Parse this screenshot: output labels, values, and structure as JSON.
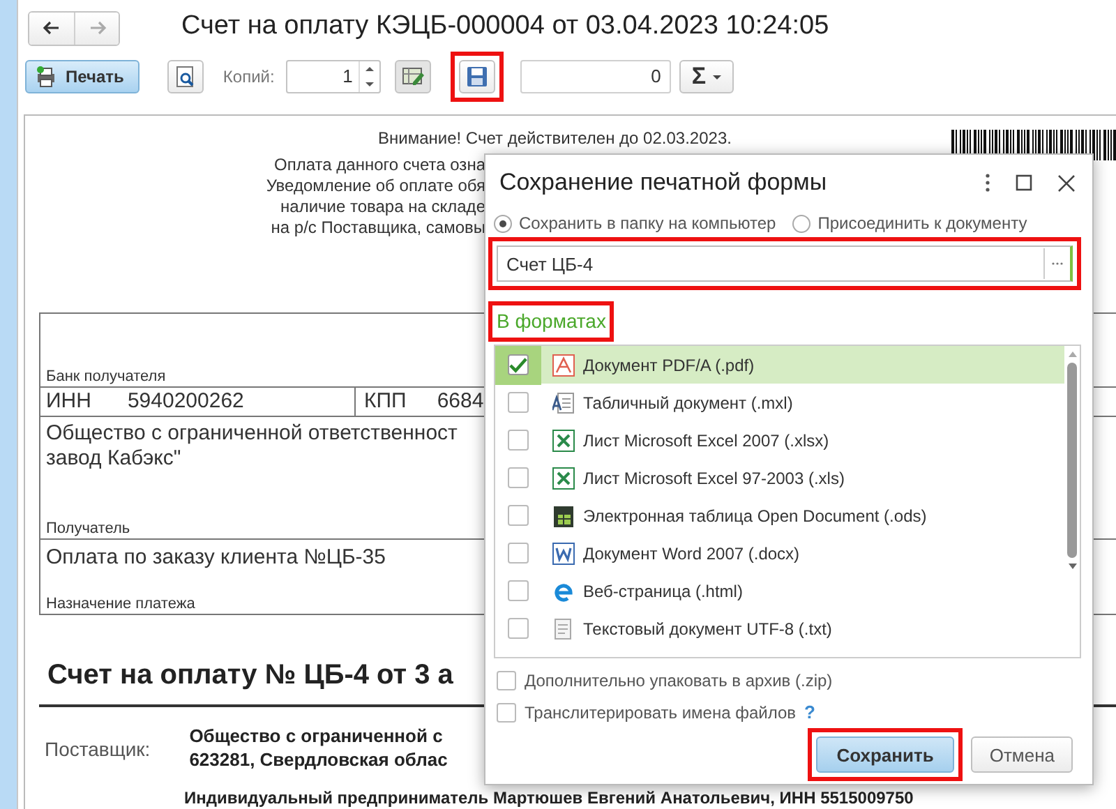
{
  "window": {
    "title": "Счет на оплату КЭЦБ-000004 от 03.04.2023 10:24:05"
  },
  "toolbar": {
    "print_button": "Печать",
    "copies_label": "Копий:",
    "copies_value": "1",
    "save_highlighted": true,
    "sum_value": "0",
    "sum_symbol": "Σ"
  },
  "document": {
    "notice_first": "Внимание! Счет действителен до 02.03.2023.",
    "notice_lines": [
      "Оплата данного счета озна",
      "Уведомление об оплате обя",
      "наличие товара на складе",
      "на р/с Поставщика, самовы"
    ],
    "bank_label": "Банк получателя",
    "inn_label": "ИНН",
    "inn": "5940200262",
    "kpp_label": "КПП",
    "kpp": "6684",
    "recipient_lines": [
      "Общество с ограниченной ответственност",
      "завод Кабэкс\""
    ],
    "recipient_label": "Получатель",
    "purpose": "Оплата по заказу клиента №ЦБ-35",
    "purpose_label": "Назначение платежа",
    "heading": "Счет на оплату № ЦБ-4 от 3 а",
    "supplier_label": "Поставщик:",
    "supplier_lines": [
      "Общество с ограниченной с",
      "623281, Свердловская облас"
    ],
    "buyer_line": "Индивидуальный предприниматель Мартюшев Евгений Анатольевич, ИНН 5515009750"
  },
  "dialog": {
    "title": "Сохранение печатной формы",
    "destinations": [
      {
        "label": "Сохранить в папку на компьютер",
        "selected": true
      },
      {
        "label": "Присоединить к документу",
        "selected": false
      }
    ],
    "filename": {
      "value": "Счет ЦБ-4",
      "highlighted": true
    },
    "formats_label": {
      "text": "В форматах",
      "highlighted": true
    },
    "formats": [
      {
        "label": "Документ PDF/A (.pdf)",
        "kind": "pdf",
        "checked": true,
        "selected": true
      },
      {
        "label": "Табличный документ (.mxl)",
        "kind": "mxl",
        "checked": false,
        "selected": false
      },
      {
        "label": "Лист Microsoft Excel 2007 (.xlsx)",
        "kind": "excel",
        "checked": false,
        "selected": false
      },
      {
        "label": "Лист Microsoft Excel 97-2003 (.xls)",
        "kind": "excel",
        "checked": false,
        "selected": false
      },
      {
        "label": "Электронная таблица Open Document (.ods)",
        "kind": "ods",
        "checked": false,
        "selected": false
      },
      {
        "label": "Документ Word 2007 (.docx)",
        "kind": "word",
        "checked": false,
        "selected": false
      },
      {
        "label": "Веб-страница (.html)",
        "kind": "html",
        "checked": false,
        "selected": false
      },
      {
        "label": "Текстовый документ UTF-8 (.txt)",
        "kind": "txt",
        "checked": false,
        "selected": false
      }
    ],
    "options": [
      {
        "label": "Дополнительно упаковать в архив (.zip)",
        "checked": false
      },
      {
        "label": "Транслитерировать имена файлов",
        "checked": false,
        "help": "?"
      }
    ],
    "buttons": [
      {
        "label": "Сохранить",
        "default": true,
        "highlighted": true
      },
      {
        "label": "Отмена",
        "default": false,
        "highlighted": false
      }
    ]
  }
}
